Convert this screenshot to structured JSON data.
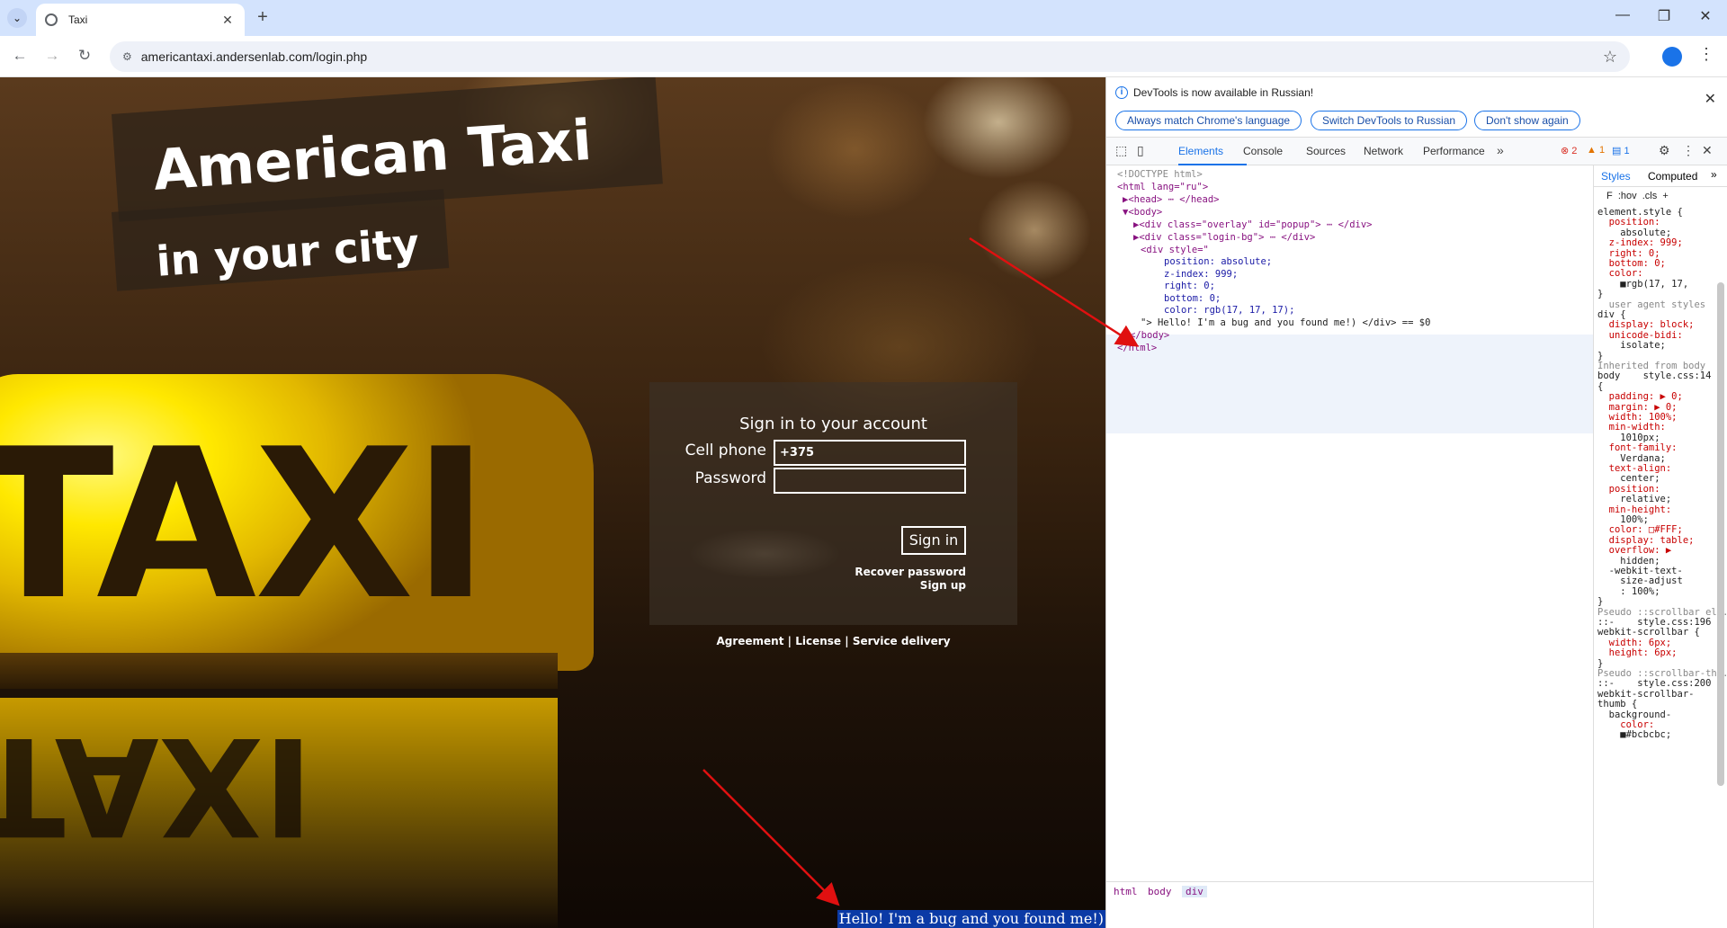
{
  "browser": {
    "tab_title": "Taxi",
    "url": "americantaxi.andersenlab.com/login.php",
    "new_tab": "+",
    "close_tab": "✕"
  },
  "page": {
    "brand_line1": "American Taxi",
    "brand_line2": "in your city",
    "taxi_word": "TAXI",
    "login": {
      "title": "Sign in to your account",
      "phone_label": "Cell phone",
      "phone_value": "+375",
      "password_label": "Password",
      "password_value": "",
      "signin_label": "Sign in",
      "recover": "Recover password",
      "signup": "Sign up"
    },
    "footer": {
      "agreement": "Agreement",
      "license": "License",
      "service": "Service delivery",
      "sep": "|"
    },
    "bug_text": "Hello! I'm a bug and you found me!)"
  },
  "devtools": {
    "info": "DevTools is now available in Russian!",
    "btn_match": "Always match Chrome's language",
    "btn_switch": "Switch DevTools to Russian",
    "btn_dont": "Don't show again",
    "tabs": [
      "Elements",
      "Console",
      "Sources",
      "Network",
      "Performance"
    ],
    "errors": "2",
    "warnings": "1",
    "messages": "1",
    "code": [
      "<!DOCTYPE html>",
      "<html lang=\"ru\">",
      "▶<head> ⋯ </head>",
      "▼<body>",
      "▶<div class=\"overlay\" id=\"popup\"> ⋯ </div>",
      "▶<div class=\"login-bg\"> ⋯ </div>",
      "<div style=\"",
      "position: absolute;",
      "z-index: 999;",
      "right: 0;",
      "bottom: 0;",
      "color: rgb(17, 17, 17);",
      "\"> Hello! I'm a bug and you found me!) </div> == $0",
      "</body>",
      "</html>"
    ],
    "breadcrumbs": [
      "html",
      "body",
      "div"
    ],
    "styles_tabs": [
      "Styles",
      "Computed"
    ],
    "styles_filter": "F  :hov  .cls  +",
    "styles_lines": [
      "element.style {",
      "  position:",
      "    absolute;",
      "  z-index: 999;",
      "  right: 0;",
      "  bottom: 0;",
      "  color:",
      "    ■rgb(17, 17,",
      "}",
      "  user agent styles",
      "div {",
      "  display: block;",
      "  unicode-bidi:",
      "    isolate;",
      "}",
      "Inherited from body",
      "body    style.css:14",
      "{",
      "  padding: ▶ 0;",
      "  margin: ▶ 0;",
      "  width: 100%;",
      "  min-width:",
      "    1010px;",
      "  font-family:",
      "    Verdana;",
      "  text-align:",
      "    center;",
      "  position:",
      "    relative;",
      "  min-height:",
      "    100%;",
      "  color: □#FFF;",
      "  display: table;",
      "  overflow: ▶",
      "    hidden;",
      "  -webkit-text-",
      "    size-adjust",
      "    : 100%;",
      "}",
      "Pseudo ::scrollbar ele...",
      "::-    style.css:196",
      "webkit-scrollbar {",
      "  width: 6px;",
      "  height: 6px;",
      "}",
      "Pseudo ::scrollbar-th...",
      "::-    style.css:200",
      "webkit-scrollbar-",
      "thumb {",
      "  background-",
      "    color:",
      "    ■#bcbcbc;"
    ]
  },
  "colors": {
    "accent": "#1a73e8",
    "bug_bg": "#0b3aa6",
    "arrow": "#e01010",
    "taxi_yellow": "#ffe800"
  }
}
